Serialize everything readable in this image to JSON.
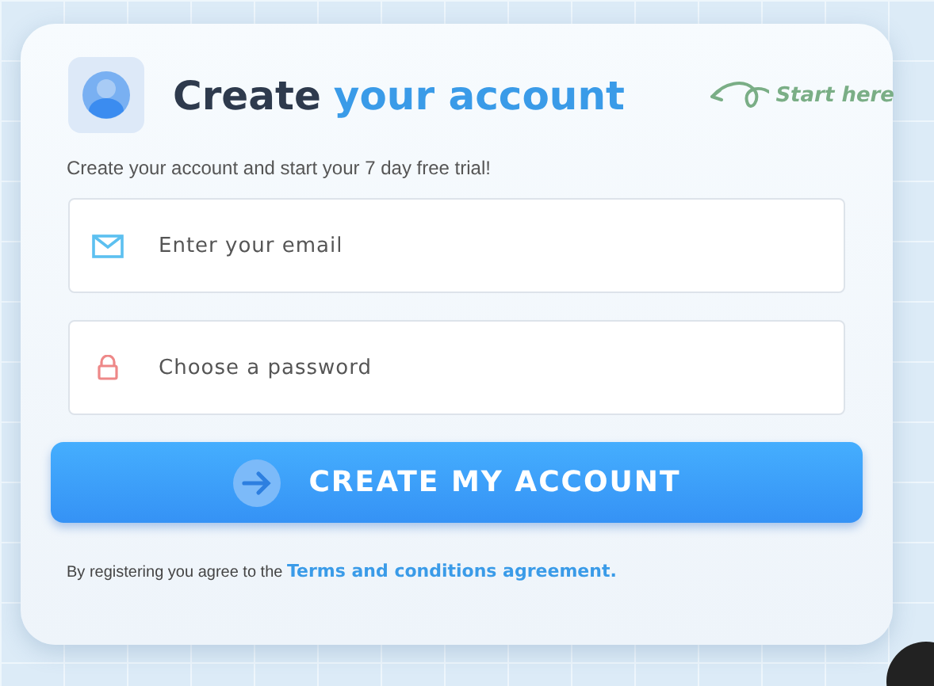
{
  "title": {
    "text": "Create",
    "highlight": "your account"
  },
  "hint": "Start here",
  "subtitle": "Create your account and start your 7 day free trial!",
  "fields": [
    {
      "kind": "email",
      "placeholder": "Enter your email"
    },
    {
      "kind": "password",
      "placeholder": "Choose a password"
    }
  ],
  "submit": "CREATE MY ACCOUNT",
  "terms": {
    "text": "By registering you agree to the",
    "link": "Terms and conditions agreement."
  }
}
